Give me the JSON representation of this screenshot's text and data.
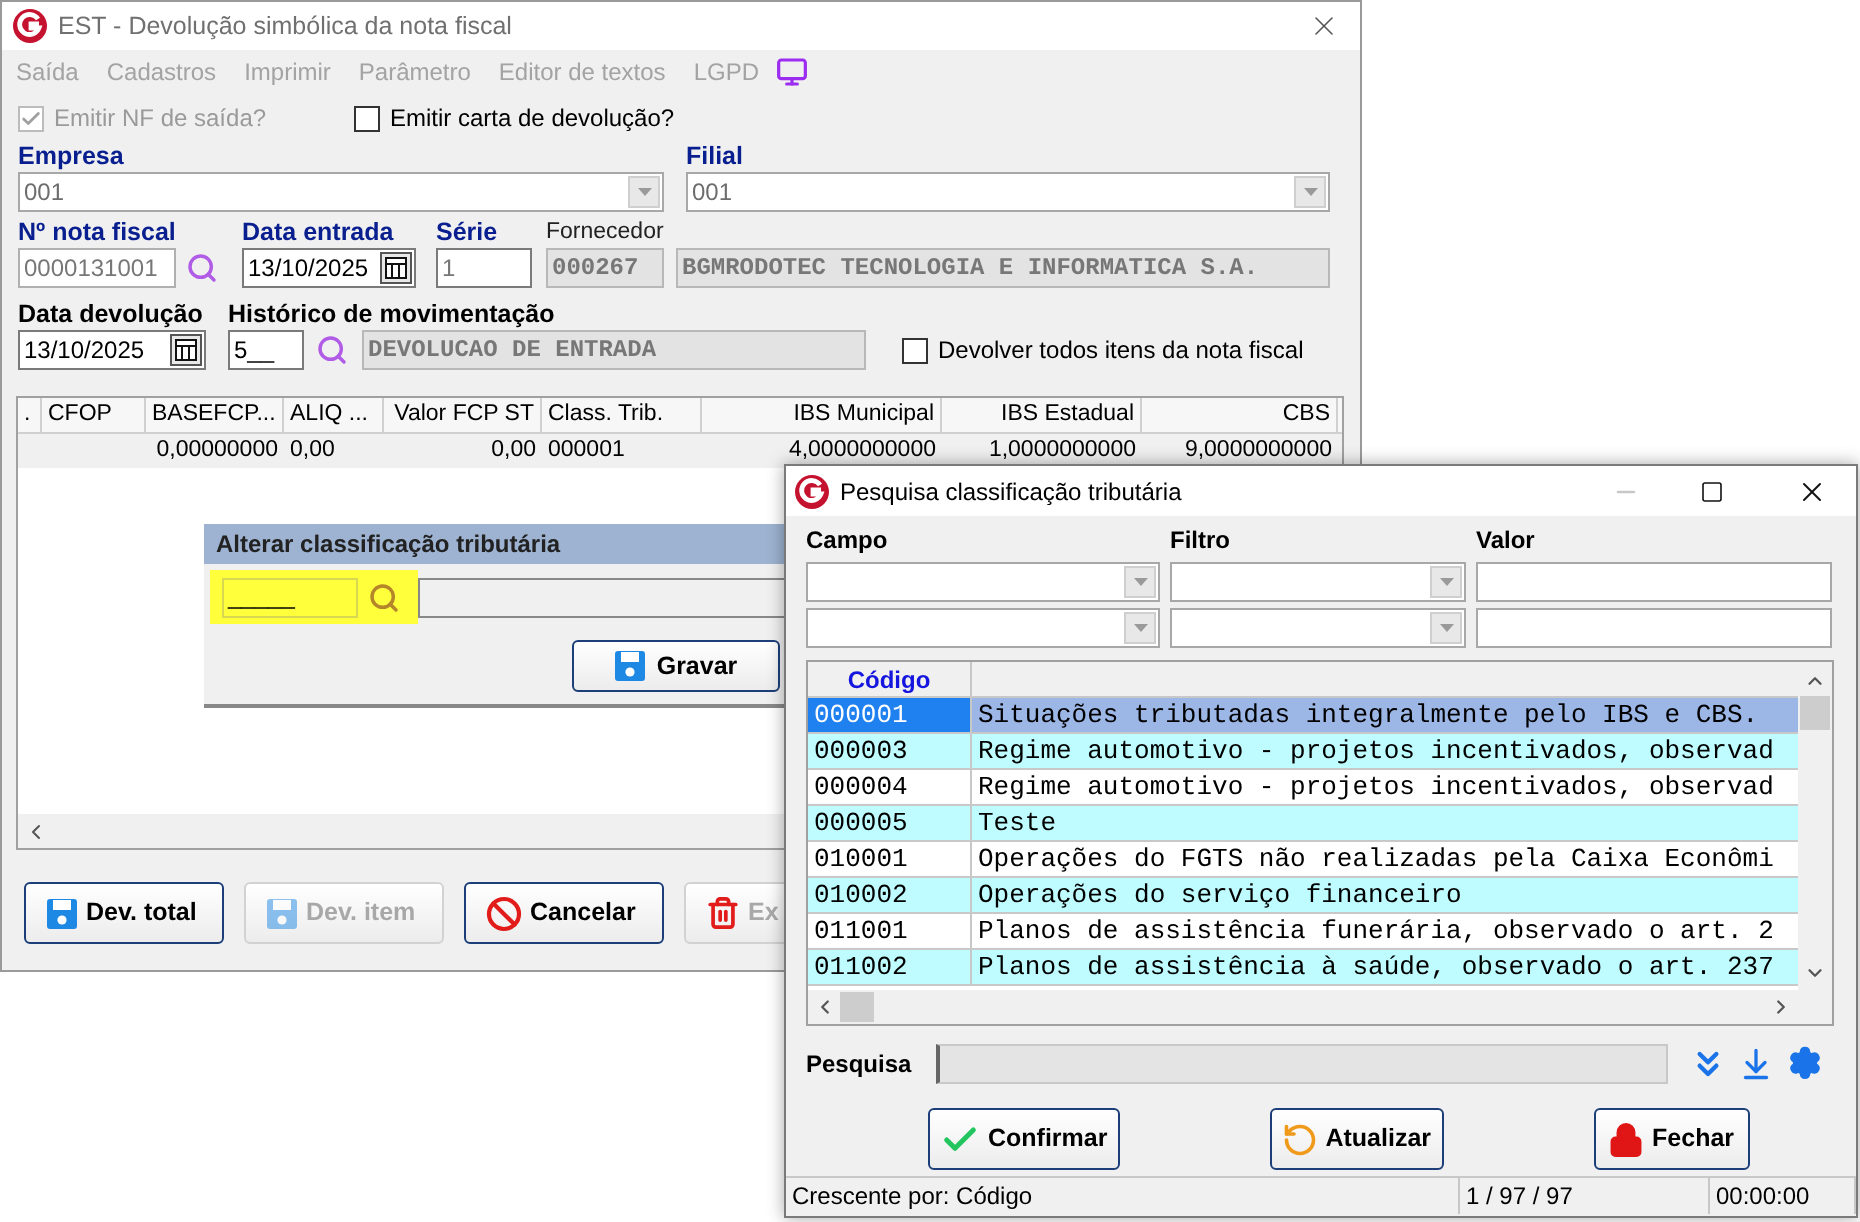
{
  "main_window": {
    "title": "EST - Devolução simbólica da nota fiscal",
    "menu": [
      {
        "label": "Saída",
        "disabled": true
      },
      {
        "label": "Cadastros",
        "disabled": true
      },
      {
        "label": "Imprimir",
        "disabled": true
      },
      {
        "label": "Parâmetro",
        "disabled": true
      },
      {
        "label": "Editor de textos",
        "disabled": true
      },
      {
        "label": "LGPD",
        "disabled": true
      }
    ],
    "options": [
      {
        "label": "Emitir NF de saída?",
        "checked": true,
        "disabled": true
      },
      {
        "label": "Emitir carta de devolução?",
        "checked": false,
        "disabled": false
      }
    ],
    "empresa": {
      "label": "Empresa",
      "value": "001"
    },
    "filial": {
      "label": "Filial",
      "value": "001"
    },
    "nota_fiscal": {
      "label": "Nº nota fiscal",
      "value": "0000131001"
    },
    "data_entrada": {
      "label": "Data entrada",
      "value": "13/10/2025"
    },
    "serie": {
      "label": "Série",
      "value": "1"
    },
    "fornecedor": {
      "label": "Fornecedor",
      "code": "000267",
      "name": "BGMRODOTEC TECNOLOGIA E INFORMATICA S.A."
    },
    "data_devolucao": {
      "label": "Data devolução",
      "value": "13/10/2025"
    },
    "historico": {
      "label": "Histórico de movimentação",
      "code": "5__",
      "description": "DEVOLUCAO DE ENTRADA"
    },
    "devolver_todos": {
      "label": "Devolver todos itens da nota fiscal",
      "checked": false
    },
    "table": {
      "columns": [
        ".",
        "CFOP",
        "BASEFCP...",
        "ALIQ ...",
        "Valor FCP ST",
        "Class. Trib.",
        "IBS Municipal",
        "IBS Estadual",
        "CBS"
      ],
      "rows": [
        [
          "",
          "",
          "0,00000000",
          "0,00",
          "0,00",
          "000001",
          "4,0000000000",
          "1,0000000000",
          "9,0000000000"
        ]
      ]
    },
    "alterar_panel": {
      "title": "Alterar classificação tributária",
      "code": "_____",
      "button": "Gravar"
    },
    "buttons": [
      {
        "label": "Dev. total",
        "kind": "save",
        "disabled": false
      },
      {
        "label": "Dev. item",
        "kind": "save",
        "disabled": true
      },
      {
        "label": "Cancelar",
        "kind": "cancel",
        "disabled": false
      },
      {
        "label": "Ex",
        "kind": "delete",
        "disabled": true
      }
    ]
  },
  "dialog": {
    "title": "Pesquisa classificação tributária",
    "filter_labels": [
      "Campo",
      "Filtro",
      "Valor"
    ],
    "filter_rows": [
      {
        "kind": "criteria"
      },
      {
        "kind": "criteria"
      }
    ],
    "table": {
      "columns": [
        "Código"
      ],
      "rows": [
        {
          "code": "000001",
          "description": "Situações tributadas integralmente pelo IBS e CBS.",
          "selected": true
        },
        {
          "code": "000003",
          "description": "Regime automotivo - projetos incentivados, observad",
          "selected": false
        },
        {
          "code": "000004",
          "description": "Regime automotivo - projetos incentivados, observad",
          "selected": false
        },
        {
          "code": "000005",
          "description": "Teste",
          "selected": false
        },
        {
          "code": "010001",
          "description": "Operações do FGTS não realizadas pela Caixa Econômi",
          "selected": false
        },
        {
          "code": "010002",
          "description": "Operações do serviço financeiro",
          "selected": false
        },
        {
          "code": "011001",
          "description": "Planos de assistência funerária, observado o art. 2",
          "selected": false
        },
        {
          "code": "011002",
          "description": "Planos de assistência à saúde, observado o art. 237",
          "selected": false
        }
      ]
    },
    "search": {
      "label": "Pesquisa"
    },
    "buttons": [
      {
        "label": "Confirmar",
        "kind": "confirm"
      },
      {
        "label": "Atualizar",
        "kind": "refresh"
      },
      {
        "label": "Fechar",
        "kind": "close"
      }
    ],
    "status_bar": [
      "Crescente por: Código",
      "1 / 97 / 97",
      "00:00:00"
    ]
  }
}
